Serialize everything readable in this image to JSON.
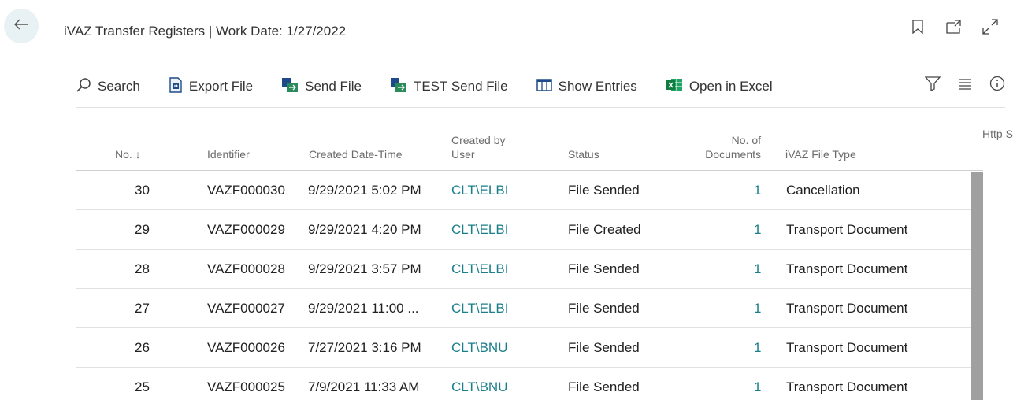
{
  "header": {
    "title": "iVAZ Transfer Registers | Work Date: 1/27/2022"
  },
  "toolbar": {
    "search": "Search",
    "export_file": "Export File",
    "send_file": "Send File",
    "test_send_file": "TEST Send File",
    "show_entries": "Show Entries",
    "open_in_excel": "Open in Excel"
  },
  "columns": {
    "no": "No. ↓",
    "identifier": "Identifier",
    "created_datetime": "Created Date-Time",
    "created_by_line1": "Created by",
    "created_by_line2": "User",
    "status": "Status",
    "no_docs_line1": "No. of",
    "no_docs_line2": "Documents",
    "file_type": "iVAZ File Type",
    "http_status": "Http S"
  },
  "rows": [
    {
      "no": "30",
      "identifier": "VAZF000030",
      "created": "9/29/2021 5:02 PM",
      "user": "CLT\\ELBI",
      "status": "File Sended",
      "docs": "1",
      "type": "Cancellation"
    },
    {
      "no": "29",
      "identifier": "VAZF000029",
      "created": "9/29/2021 4:20 PM",
      "user": "CLT\\ELBI",
      "status": "File Created",
      "docs": "1",
      "type": "Transport Document"
    },
    {
      "no": "28",
      "identifier": "VAZF000028",
      "created": "9/29/2021 3:57 PM",
      "user": "CLT\\ELBI",
      "status": "File Sended",
      "docs": "1",
      "type": "Transport Document"
    },
    {
      "no": "27",
      "identifier": "VAZF000027",
      "created": "9/29/2021 11:00 ...",
      "user": "CLT\\ELBI",
      "status": "File Sended",
      "docs": "1",
      "type": "Transport Document"
    },
    {
      "no": "26",
      "identifier": "VAZF000026",
      "created": "7/27/2021 3:16 PM",
      "user": "CLT\\BNU",
      "status": "File Sended",
      "docs": "1",
      "type": "Transport Document"
    },
    {
      "no": "25",
      "identifier": "VAZF000025",
      "created": "7/9/2021 11:33 AM",
      "user": "CLT\\BNU",
      "status": "File Sended",
      "docs": "1",
      "type": "Transport Document"
    }
  ],
  "colors": {
    "accent": "#1a7f8a",
    "back_button_bg": "#e8f1f3"
  }
}
